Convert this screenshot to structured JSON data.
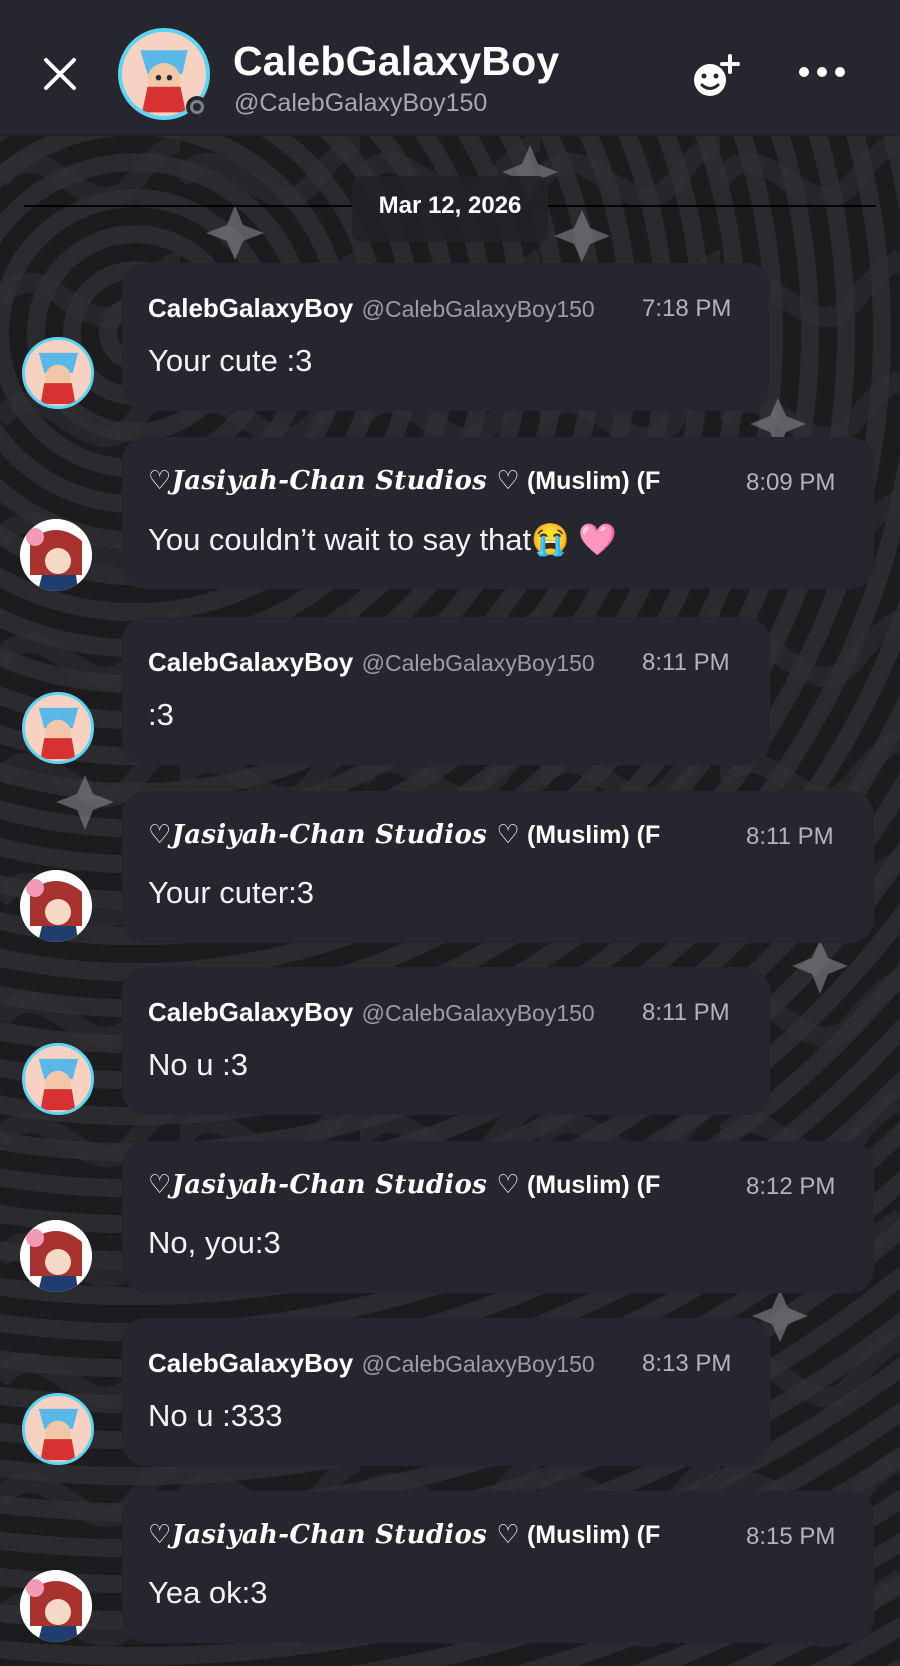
{
  "header": {
    "name": "CalebGalaxyBoy",
    "handle": "@CalebGalaxyBoy150",
    "close_icon": "close-icon",
    "add_friend_icon": "add-friend-icon",
    "more_icon": "more-icon"
  },
  "date_divider": "Mar 12, 2026",
  "users": {
    "caleb": {
      "name": "CalebGalaxyBoy",
      "handle": "@CalebGalaxyBoy150"
    },
    "jasiyah": {
      "name_fancy": "♡𝑱𝒂𝒔𝒊𝒚𝒂𝒉-𝑪𝒉𝒂𝒏 𝑺𝒕𝒖𝒅𝒊𝒐𝒔 ♡",
      "name_suffix": " (Muslim) (F"
    }
  },
  "messages": [
    {
      "author": "caleb",
      "time": "7:18 PM",
      "text": "Your cute :3"
    },
    {
      "author": "jasiyah",
      "time": "8:09 PM",
      "text": "You couldn’t wait to say that😭 🩷"
    },
    {
      "author": "caleb",
      "time": "8:11 PM",
      "text": ":3"
    },
    {
      "author": "jasiyah",
      "time": "8:11 PM",
      "text": "Your cuter:3"
    },
    {
      "author": "caleb",
      "time": "8:11 PM",
      "text": "No u :3"
    },
    {
      "author": "jasiyah",
      "time": "8:12 PM",
      "text": "No, you:3"
    },
    {
      "author": "caleb",
      "time": "8:13 PM",
      "text": "No u :333"
    },
    {
      "author": "jasiyah",
      "time": "8:15 PM",
      "text": "Yea ok:3"
    }
  ],
  "colors": {
    "header_bg": "#26272e",
    "bubble_bg": "#26262e",
    "avatar_ring": "#5fd3f2"
  }
}
